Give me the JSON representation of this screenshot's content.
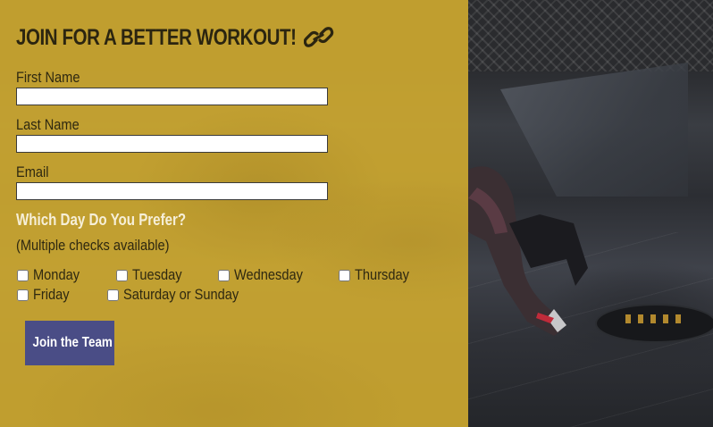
{
  "form": {
    "title": "JOIN FOR A BETTER WORKOUT!",
    "title_icon": "link-icon",
    "fields": [
      {
        "label": "First Name",
        "value": ""
      },
      {
        "label": "Last Name",
        "value": ""
      },
      {
        "label": "Email",
        "value": ""
      }
    ],
    "question": "Which Day Do You Prefer?",
    "question_note": "(Multiple checks available)",
    "days": [
      "Monday",
      "Tuesday",
      "Wednesday",
      "Thursday",
      "Friday",
      "Saturday or Sunday"
    ],
    "submit_label": "Join the Team"
  },
  "colors": {
    "overlay": "#cda830",
    "button": "#4a4d86",
    "question_text": "#f6efd8"
  }
}
